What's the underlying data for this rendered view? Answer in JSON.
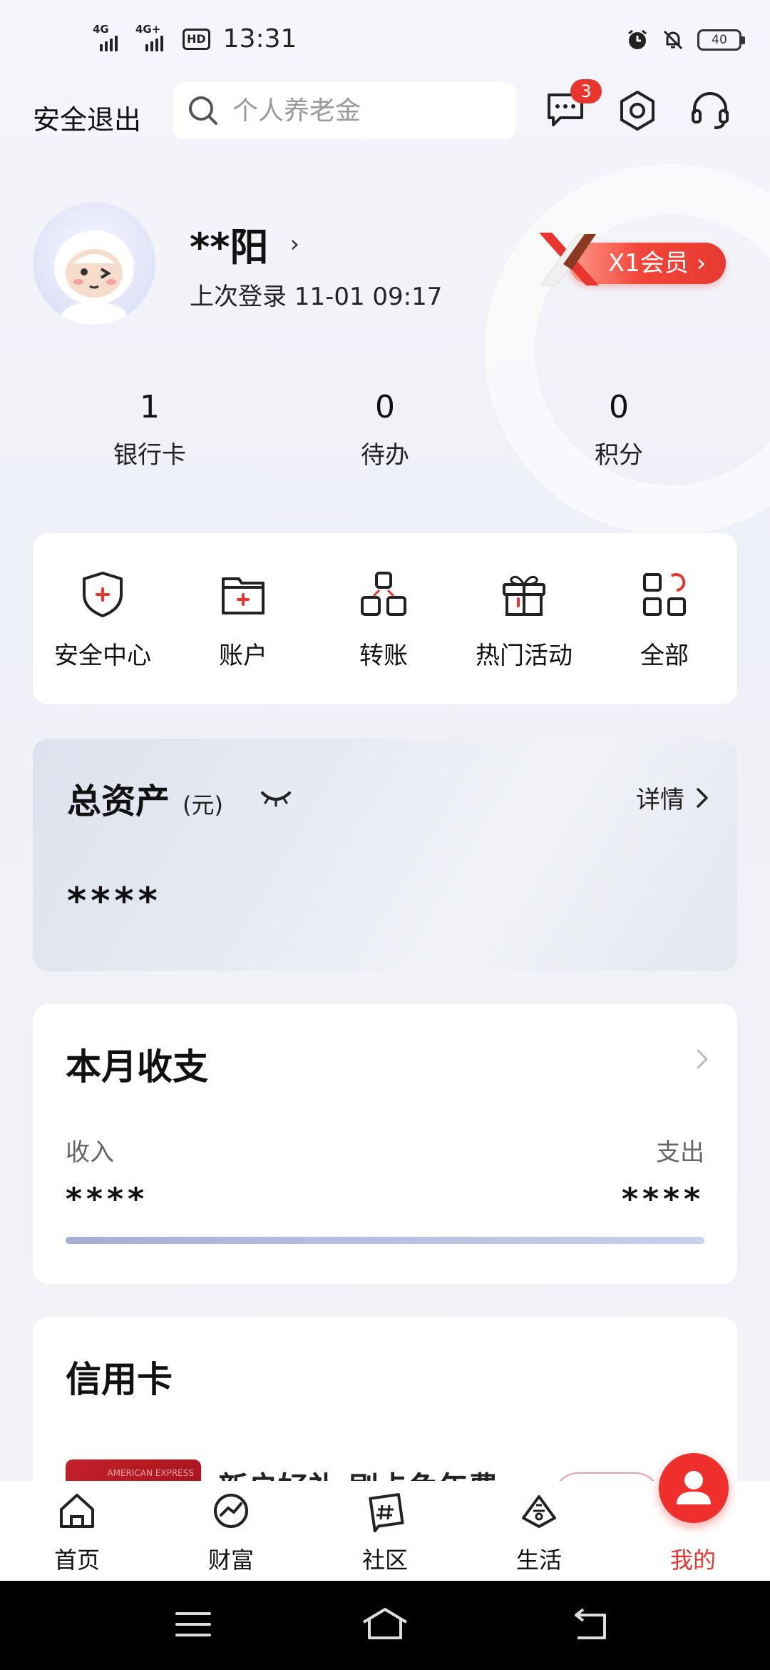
{
  "status_bar": {
    "network1": "4G",
    "network2": "4G+",
    "hd": "HD",
    "time": "13:31",
    "battery": "40"
  },
  "header": {
    "logout_label": "安全退出",
    "search_placeholder": "个人养老金",
    "message_badge": "3"
  },
  "profile": {
    "username": "**阳",
    "chevron": "›",
    "last_login": "上次登录 11-01 09:17",
    "member_label": "X1会员 ›"
  },
  "stats": [
    {
      "value": "1",
      "label": "银行卡"
    },
    {
      "value": "0",
      "label": "待办"
    },
    {
      "value": "0",
      "label": "积分"
    }
  ],
  "quick_actions": [
    {
      "label": "安全中心",
      "icon": "shield-icon"
    },
    {
      "label": "账户",
      "icon": "folder-icon"
    },
    {
      "label": "转账",
      "icon": "transfer-icon"
    },
    {
      "label": "热门活动",
      "icon": "gift-icon"
    },
    {
      "label": "全部",
      "icon": "grid-icon"
    }
  ],
  "assets": {
    "title": "总资产",
    "unit": "(元)",
    "details_label": "详情",
    "value": "****"
  },
  "monthly": {
    "title": "本月收支",
    "income_label": "收入",
    "expense_label": "支出",
    "income_value": "****",
    "expense_value": "****"
  },
  "credit": {
    "title": "信用卡",
    "promo_text": "新户好礼 刷卡免年费",
    "card_text": "AMERICAN EXPRESS"
  },
  "bottom_nav": [
    {
      "label": "首页",
      "icon": "home-icon",
      "active": false
    },
    {
      "label": "财富",
      "icon": "wealth-icon",
      "active": false
    },
    {
      "label": "社区",
      "icon": "community-icon",
      "active": false
    },
    {
      "label": "生活",
      "icon": "life-icon",
      "active": false
    },
    {
      "label": "我的",
      "icon": "profile-icon",
      "active": true
    }
  ],
  "colors": {
    "accent": "#e8362f",
    "background": "#f2f3f8"
  }
}
